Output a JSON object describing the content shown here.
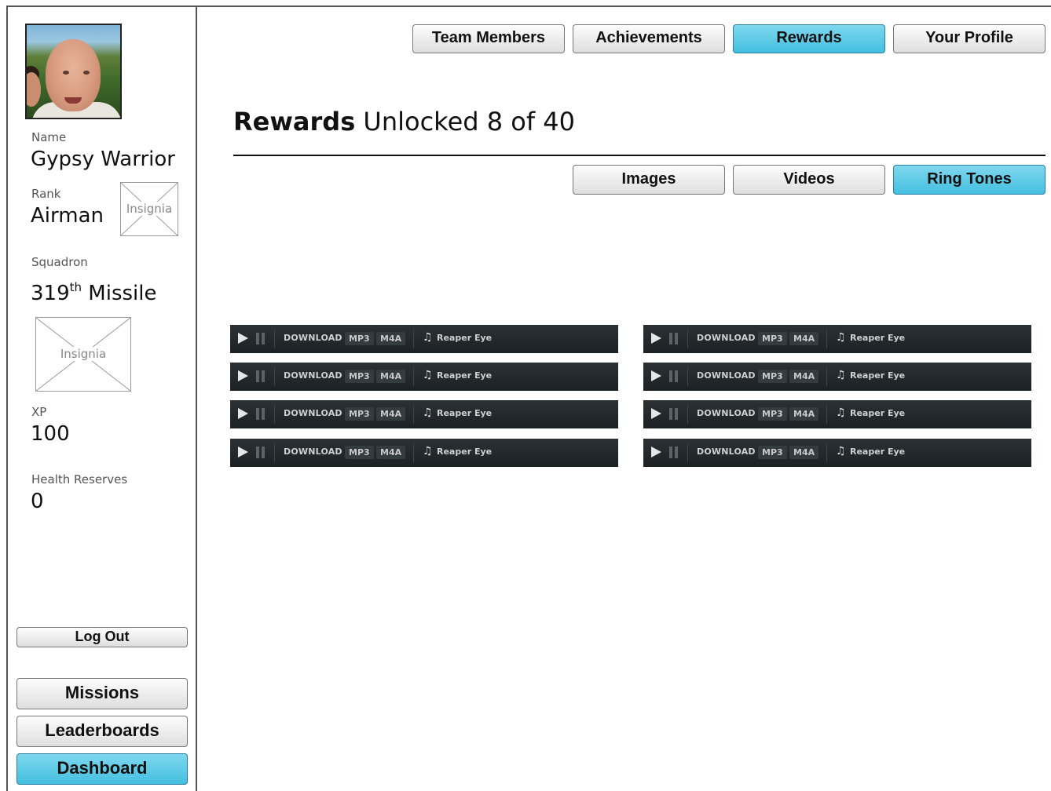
{
  "profile": {
    "name_label": "Name",
    "name": "Gypsy Warrior",
    "rank_label": "Rank",
    "rank": "Airman",
    "rank_insignia_label": "Insignia",
    "squadron_label": "Squadron",
    "squadron_number": "319",
    "squadron_suffix": "th",
    "squadron_name": "Missile",
    "squadron_insignia_label": "Insignia",
    "xp_label": "XP",
    "xp": "100",
    "health_label": "Health Reserves",
    "health": "0"
  },
  "sidebar": {
    "logout": "Log Out",
    "missions": "Missions",
    "leaderboards": "Leaderboards",
    "dashboard": "Dashboard",
    "active": "Dashboard"
  },
  "nav": {
    "team_members": "Team Members",
    "achievements": "Achievements",
    "rewards": "Rewards",
    "your_profile": "Your Profile",
    "active": "Rewards"
  },
  "page": {
    "title_bold": "Rewards",
    "title_rest": " Unlocked 8 of 40"
  },
  "subnav": {
    "images": "Images",
    "videos": "Videos",
    "ring_tones": "Ring Tones",
    "active": "Ring Tones"
  },
  "players": {
    "download_label": "DOWNLOAD",
    "mp3_label": "MP3",
    "m4a_label": "M4A",
    "tracks": [
      "Reaper Eye",
      "Reaper Eye",
      "Reaper Eye",
      "Reaper Eye",
      "Reaper Eye",
      "Reaper Eye",
      "Reaper Eye",
      "Reaper Eye"
    ]
  },
  "colors": {
    "active_button": "#43bfe0",
    "player_bg": "#1f2427"
  }
}
